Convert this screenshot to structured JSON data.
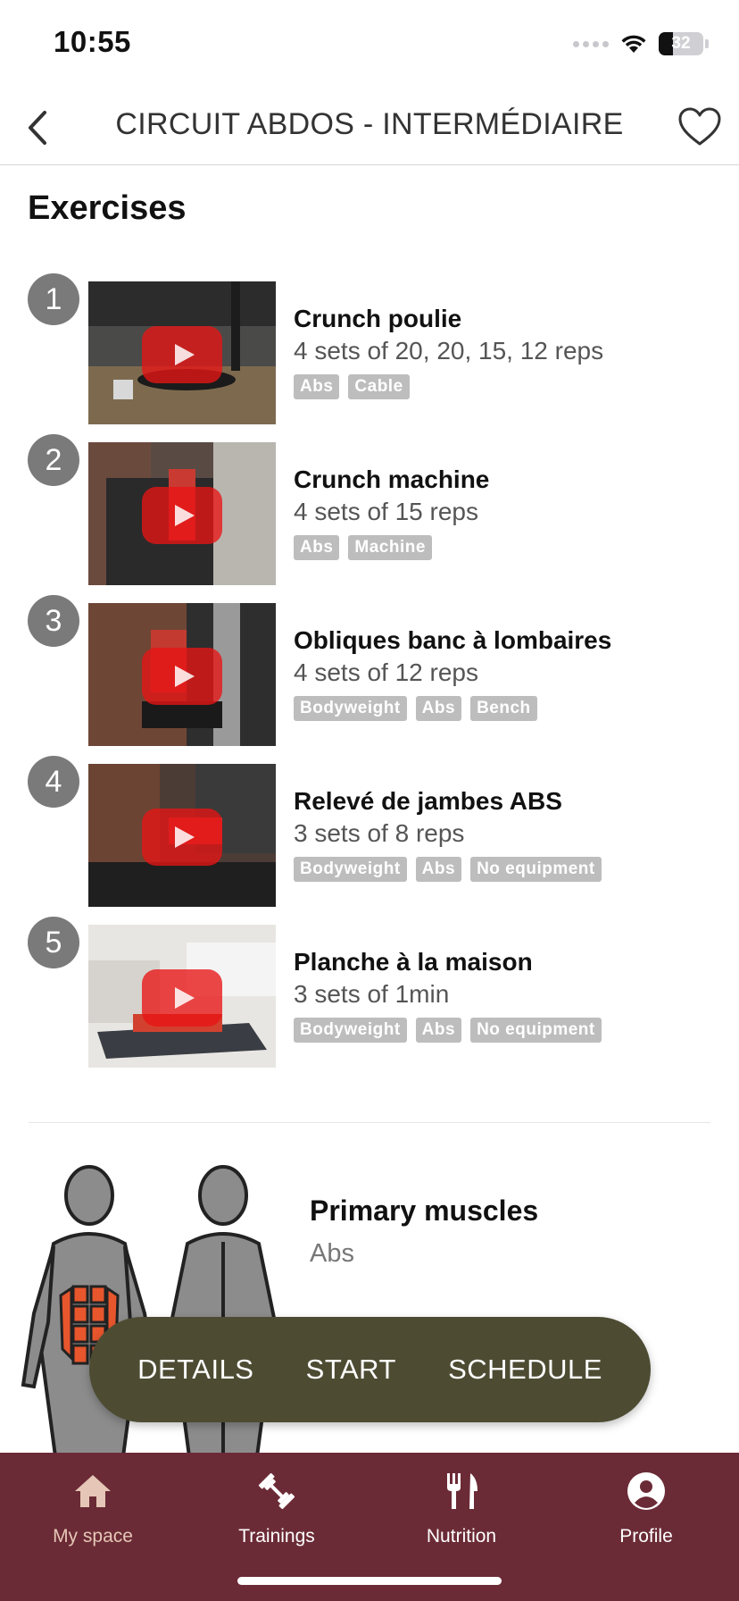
{
  "status_bar": {
    "time": "10:55",
    "battery": "32",
    "battery_level": 0.32
  },
  "header": {
    "title": "CIRCUIT ABDOS - INTERMÉDIAIRE",
    "back_icon": "chevron-left-icon",
    "favorite_icon": "heart-outline-icon"
  },
  "section": {
    "title": "Exercises"
  },
  "exercises": [
    {
      "number": "1",
      "name": "Crunch poulie",
      "sets": "4 sets of 20, 20, 15, 12 reps",
      "tags": [
        "Abs",
        "Cable"
      ]
    },
    {
      "number": "2",
      "name": "Crunch machine",
      "sets": "4 sets of 15 reps",
      "tags": [
        "Abs",
        "Machine"
      ]
    },
    {
      "number": "3",
      "name": "Obliques banc à lombaires",
      "sets": "4 sets of 12 reps",
      "tags": [
        "Bodyweight",
        "Abs",
        "Bench"
      ]
    },
    {
      "number": "4",
      "name": "Relevé de jambes ABS",
      "sets": "3 sets of 8 reps",
      "tags": [
        "Bodyweight",
        "Abs",
        "No equipment"
      ]
    },
    {
      "number": "5",
      "name": "Planche à la maison",
      "sets": "3 sets of 1min",
      "tags": [
        "Bodyweight",
        "Abs",
        "No equipment"
      ]
    }
  ],
  "muscles": {
    "title": "Primary muscles",
    "value": "Abs"
  },
  "actions": {
    "details": "DETAILS",
    "start": "START",
    "schedule": "SCHEDULE"
  },
  "tabs": [
    {
      "label": "My space",
      "icon": "home-icon",
      "active": true
    },
    {
      "label": "Trainings",
      "icon": "dumbbell-icon",
      "active": false
    },
    {
      "label": "Nutrition",
      "icon": "fork-knife-icon",
      "active": false
    },
    {
      "label": "Profile",
      "icon": "profile-icon",
      "active": false
    }
  ],
  "colors": {
    "tab_bar": "#6b2b36",
    "action_bar": "#4d4c33",
    "active_tab": "#e6c6b6",
    "tag": "#bdbdbd",
    "number_badge": "#7a7a7a",
    "abs_highlight": "#e8562d"
  }
}
